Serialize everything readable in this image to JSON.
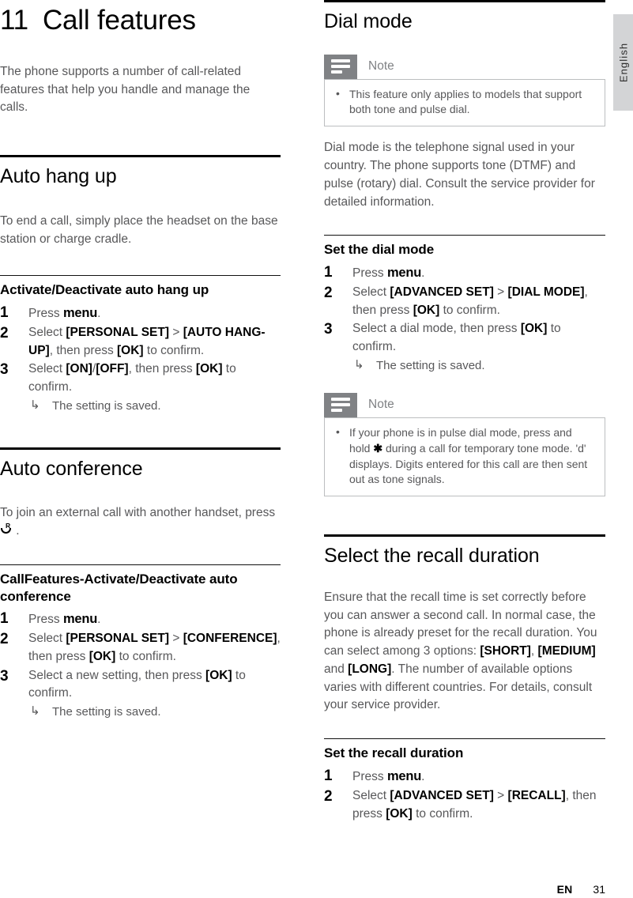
{
  "page": {
    "language_tab": "English",
    "footer": {
      "locale": "EN",
      "page_number": "31"
    }
  },
  "left_column": {
    "chapter": {
      "number": "11",
      "title": "Call features"
    },
    "intro": "The phone supports a number of call-related features that help you handle and manage the calls.",
    "sections": [
      {
        "title": "Auto hang up",
        "body": "To end a call, simply place the headset on the base station or charge cradle.",
        "subsection": {
          "title": "Activate/Deactivate auto hang up",
          "steps": [
            {
              "num": "1",
              "text_pre": "Press ",
              "keyword": "menu",
              "text_post": "."
            },
            {
              "num": "2",
              "text": "Select [PERSONAL SET] > [AUTO HANG-UP], then press [OK] to confirm."
            },
            {
              "num": "3",
              "text": "Select [ON]/[OFF], then press [OK] to confirm.",
              "result": "The setting is saved."
            }
          ]
        }
      },
      {
        "title": "Auto conference",
        "body_pre": "To join an external call with another handset, press ",
        "body_icon": "conference-key-icon",
        "body_post": " .",
        "subsection": {
          "title": "CallFeatures-Activate/Deactivate auto conference",
          "steps": [
            {
              "num": "1",
              "text_pre": "Press ",
              "keyword": "menu",
              "text_post": "."
            },
            {
              "num": "2",
              "text": "Select [PERSONAL SET] > [CONFERENCE], then press [OK] to confirm."
            },
            {
              "num": "3",
              "text": "Select a new setting, then press [OK] to confirm.",
              "result": "The setting is saved."
            }
          ]
        }
      }
    ]
  },
  "right_column": {
    "sections": [
      {
        "title": "Dial mode",
        "note": {
          "label": "Note",
          "icon": "note-lines-icon",
          "items": [
            "This feature only applies to models that support both tone and pulse dial."
          ]
        },
        "body": "Dial mode is the telephone signal used in your country. The phone supports tone (DTMF) and pulse (rotary) dial. Consult the service provider for detailed information.",
        "subsection": {
          "title": "Set the dial mode",
          "steps": [
            {
              "num": "1",
              "text_pre": "Press ",
              "keyword": "menu",
              "text_post": "."
            },
            {
              "num": "2",
              "text": "Select [ADVANCED SET] > [DIAL MODE], then press [OK] to confirm."
            },
            {
              "num": "3",
              "text": "Select a dial mode, then press [OK] to confirm.",
              "result": "The setting is saved."
            }
          ]
        },
        "note2": {
          "label": "Note",
          "icon": "note-lines-icon",
          "items": [
            "If your phone is in pulse dial mode, press and hold ✱ during a call for temporary tone mode. 'd' displays. Digits entered for this call are then sent out as tone signals."
          ]
        }
      },
      {
        "title": "Select the recall duration",
        "body": "Ensure that the recall time is set correctly before you can answer a second call. In normal case, the phone is already preset for the recall duration. You can select among 3 options: [SHORT], [MEDIUM] and [LONG]. The number of available options varies with different countries. For details, consult your service provider.",
        "subsection": {
          "title": "Set the recall duration",
          "steps": [
            {
              "num": "1",
              "text_pre": "Press ",
              "keyword": "menu",
              "text_post": "."
            },
            {
              "num": "2",
              "text": "Select [ADVANCED SET] > [RECALL], then press [OK] to confirm."
            }
          ]
        }
      }
    ]
  },
  "colors": {
    "body_text": "#58585a",
    "heading_text": "#000000",
    "note_icon_bg": "#808285",
    "note_border": "#bcbec0",
    "lang_tab_bg": "#d3d4d6"
  }
}
